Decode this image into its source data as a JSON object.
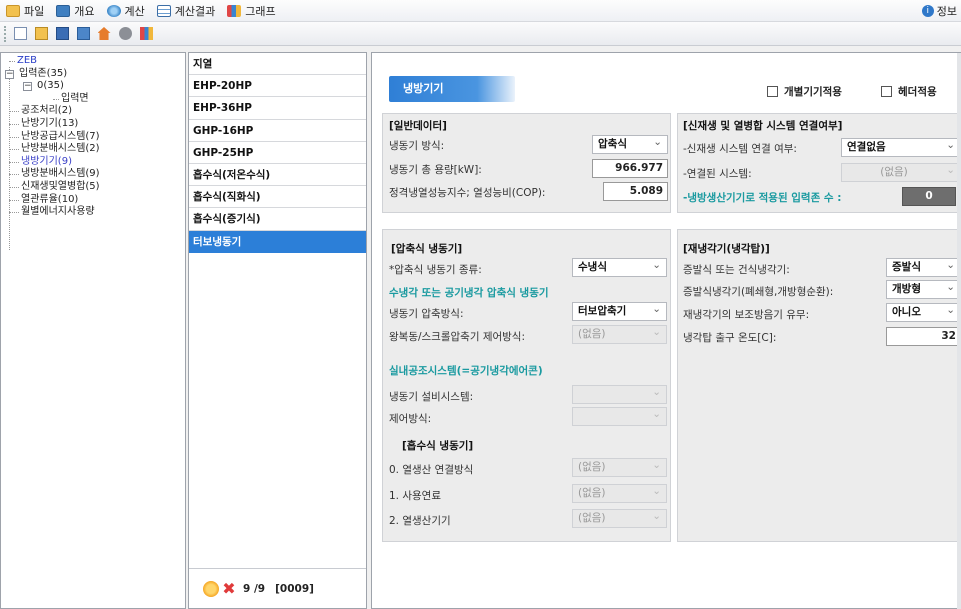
{
  "menu": {
    "items": [
      {
        "label": "파일",
        "icon": "folder-icon"
      },
      {
        "label": "개요",
        "icon": "overview-icon"
      },
      {
        "label": "계산",
        "icon": "calculate-icon"
      },
      {
        "label": "계산결과",
        "icon": "table-icon"
      },
      {
        "label": "그래프",
        "icon": "chart-icon"
      }
    ],
    "info_label": "정보"
  },
  "toolbar": {
    "buttons": [
      "new-file-icon",
      "open-folder-icon",
      "save-icon",
      "save-as-icon",
      "home-icon",
      "settings-gear-icon",
      "chart-icon"
    ]
  },
  "tree": {
    "root": "ZEB",
    "input_zone": "입력존(35)",
    "zone0": "0(35)",
    "input_surface": "입력면",
    "items": [
      "공조처리(2)",
      "난방기기(13)",
      "난방공급시스템(7)",
      "난방분배시스템(2)",
      "냉방기기(9)",
      "냉방분배시스템(9)",
      "신재생및열병합(5)",
      "열관류율(10)",
      "월별에너지사용량"
    ]
  },
  "list": {
    "items": [
      "지열",
      "EHP-20HP",
      "EHP-36HP",
      "GHP-16HP",
      "GHP-25HP",
      "흡수식(저온수식)",
      "흡수식(직화식)",
      "흡수식(증기식)",
      "터보냉동기"
    ],
    "selected_index": 8,
    "footer_count": "9 /9",
    "footer_code": "[0009]"
  },
  "main": {
    "tab_title": "냉방기기",
    "check_individual": "개별기기적용",
    "check_header": "헤더적용",
    "general": {
      "title": "[일반데이터]",
      "method_label": "냉동기 방식:",
      "method_value": "압축식",
      "capacity_label": "냉동기 총 용량[kW]:",
      "capacity_value": "966.977",
      "cop_label": "정격냉열성능지수; 열성능비(COP):",
      "cop_value": "5.089"
    },
    "renewable": {
      "title": "[신재생 및 열병합 시스템 연결여부]",
      "connect_label": "-신재생 시스템 연결 여부:",
      "connect_value": "연결없음",
      "system_label": "-연결된 시스템:",
      "system_value": "(없음)",
      "zone_count_label": "-냉방생산기기로 적용된 입력존 수 :",
      "zone_count_value": "0"
    },
    "compression": {
      "title": "[압축식 냉동기]",
      "type_label": "*압축식 냉동기 종류:",
      "type_value": "수냉식",
      "subtitle": "수냉각 또는 공기냉각 압축식 냉동기",
      "comp_method_label": "냉동기 압축방식:",
      "comp_method_value": "터보압축기",
      "control_label": "왕복동/스크롤압축기 제어방식:",
      "control_value": "(없음)",
      "indoor_title": "실내공조시스템(=공기냉각에어콘)",
      "equip_label": "냉동기 설비시스템:",
      "equip_value": "",
      "ctrl_method_label": "제어방식:",
      "ctrl_method_value": ""
    },
    "absorption": {
      "title": "[흡수식 냉동기]",
      "heat_conn_label": "0. 열생산 연결방식",
      "heat_conn_value": "(없음)",
      "fuel_label": "1. 사용연료",
      "fuel_value": "(없음)",
      "heat_equip_label": "2. 열생산기기",
      "heat_equip_value": "(없음)"
    },
    "cooling_tower": {
      "title": "[재냉각기(냉각탑)]",
      "type_label": "증발식 또는 건식냉각기:",
      "type_value": "증발식",
      "evap_label": "증발식냉각기(폐쇄형,개방형순환):",
      "evap_value": "개방형",
      "aux_label": "재냉각기의 보조방음기 유무:",
      "aux_value": "아니오",
      "outlet_label": "냉각탑 출구 온도[C]:",
      "outlet_value": "32"
    }
  }
}
